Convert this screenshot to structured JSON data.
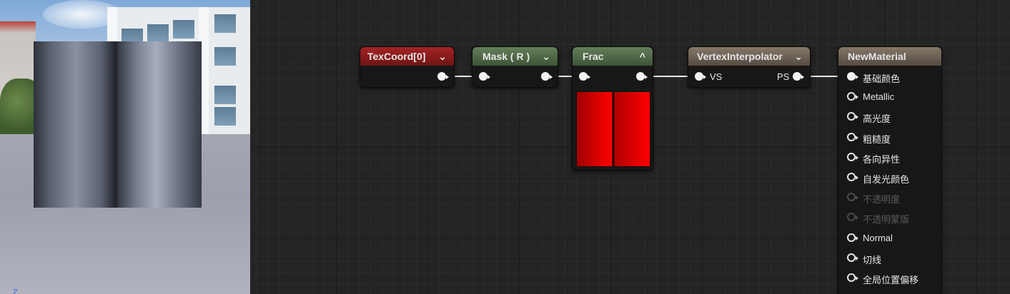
{
  "viewport": {
    "axis_label": "Z"
  },
  "nodes": {
    "texcoord": {
      "title": "TexCoord[0]",
      "header_color": "#8a1c1c",
      "chevron": "⌄"
    },
    "mask": {
      "title": "Mask ( R )",
      "header_color": "#4f6b46",
      "chevron": "⌄"
    },
    "frac": {
      "title": "Frac",
      "header_color": "#4f6b46",
      "chevron": "^"
    },
    "vertexinterp": {
      "title": "VertexInterpolator",
      "header_color": "#6e6357",
      "chevron": "⌄",
      "input_label": "VS",
      "output_label": "PS"
    },
    "newmaterial": {
      "title": "NewMaterial",
      "header_color": "#6e6357",
      "inputs": [
        {
          "label": "基础颜色",
          "state": "connected"
        },
        {
          "label": "Metallic",
          "state": "active"
        },
        {
          "label": "高光度",
          "state": "active"
        },
        {
          "label": "粗糙度",
          "state": "active"
        },
        {
          "label": "各向异性",
          "state": "active"
        },
        {
          "label": "自发光颜色",
          "state": "active"
        },
        {
          "label": "不透明度",
          "state": "disabled"
        },
        {
          "label": "不透明蒙版",
          "state": "disabled"
        },
        {
          "label": "Normal",
          "state": "active"
        },
        {
          "label": "切线",
          "state": "active"
        },
        {
          "label": "全局位置偏移",
          "state": "active"
        }
      ]
    }
  },
  "colors": {
    "wire": "#e8e8e8",
    "grid_bg": "#242424",
    "pin_active": "#f2f2f2",
    "pin_disabled": "#4c4c4c"
  }
}
